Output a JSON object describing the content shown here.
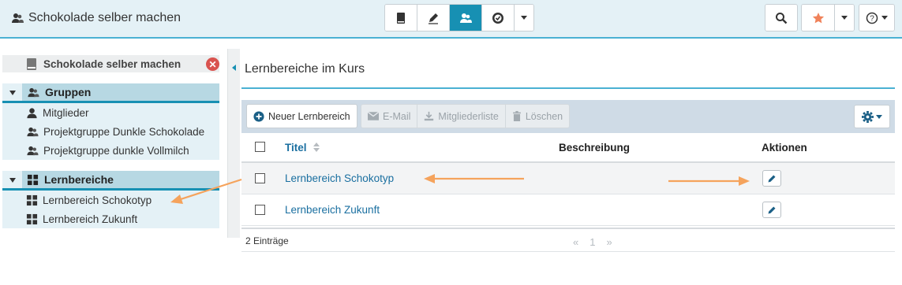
{
  "header": {
    "title": "Schokolade selber machen",
    "nav_buttons": [
      "book-icon",
      "pencil-icon",
      "users-icon",
      "badge-icon",
      "chevron-down-icon"
    ],
    "right_buttons": [
      "search-icon",
      "star-icon",
      "help-icon"
    ],
    "accent": "#1790b3",
    "star_color": "#f0825a"
  },
  "sidebar": {
    "course": "Schokolade selber machen",
    "sections": [
      {
        "label": "Gruppen",
        "items": [
          "Mitglieder",
          "Projektgruppe Dunkle Schokolade",
          "Projektgruppe dunkle Vollmilch"
        ]
      },
      {
        "label": "Lernbereiche",
        "items": [
          "Lernbereich Schokotyp",
          "Lernbereich Zukunft"
        ]
      }
    ]
  },
  "main": {
    "title": "Lernbereiche im Kurs",
    "toolbar": {
      "new": "Neuer Lernbereich",
      "email": "E-Mail",
      "members": "Mitgliederliste",
      "delete": "Löschen"
    },
    "table": {
      "columns": [
        "Titel",
        "Beschreibung",
        "Aktionen"
      ],
      "rows": [
        {
          "title": "Lernbereich Schokotyp",
          "description": ""
        },
        {
          "title": "Lernbereich Zukunft",
          "description": ""
        }
      ]
    },
    "footer": {
      "count": "2 Einträge",
      "prev": "«",
      "page": "1",
      "next": "»"
    }
  },
  "annotation_color": "#f5a35c"
}
